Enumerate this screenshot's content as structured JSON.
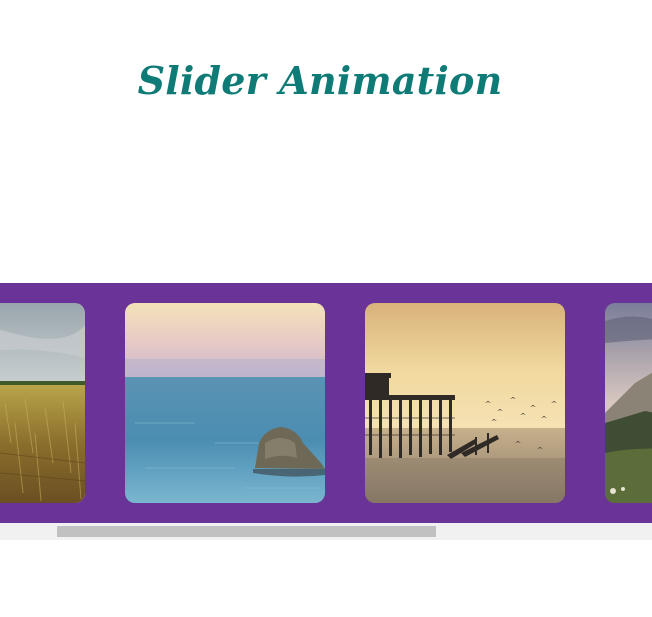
{
  "page": {
    "title": "Slider Animation"
  },
  "colors": {
    "title": "#0f7b76",
    "slider_background": "#6a3397",
    "scrollbar_track": "#f1f1f1",
    "scrollbar_thumb": "#c1c1c1"
  },
  "slider": {
    "slides": [
      {
        "scene": "wheat-field"
      },
      {
        "scene": "sea-rock"
      },
      {
        "scene": "pier-sunset"
      },
      {
        "scene": "mountain-valley"
      }
    ]
  },
  "scrollbar": {
    "thumb_position_fraction": 0.09,
    "thumb_size_fraction": 0.58
  }
}
